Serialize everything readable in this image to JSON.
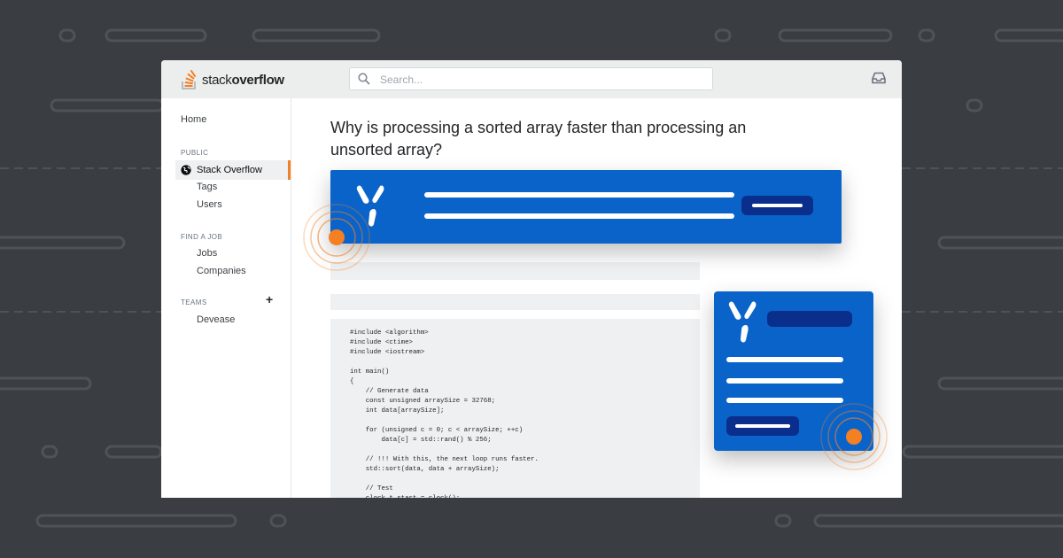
{
  "app": {
    "brand_light": "stack",
    "brand_bold": "overflow"
  },
  "search": {
    "placeholder": "Search..."
  },
  "sidebar": {
    "home": "Home",
    "public_header": "PUBLIC",
    "active_item": "Stack Overflow",
    "tags": "Tags",
    "users": "Users",
    "jobs_header": "FIND A JOB",
    "jobs": "Jobs",
    "companies": "Companies",
    "teams_header": "TEAMS",
    "teams_add": "+",
    "team_name": "Devease"
  },
  "question": {
    "title": "Why is processing a sorted array faster than processing an unsorted array?"
  },
  "code": {
    "text": "#include <algorithm>\n#include <ctime>\n#include <iostream>\n\nint main()\n{\n    // Generate data\n    const unsigned arraySize = 32768;\n    int data[arraySize];\n\n    for (unsigned c = 0; c < arraySize; ++c)\n        data[c] = std::rand() % 256;\n\n    // !!! With this, the next loop runs faster.\n    std::sort(data, data + arraySize);\n\n    // Test\n    clock_t start = clock();"
  },
  "icons": {
    "logo": "stack-overflow-logo",
    "search": "search-icon",
    "inbox": "inbox-icon",
    "globe": "globe-icon",
    "brand_mark": "teams-brand-mark-icon"
  },
  "colors": {
    "background": "#3a3d41",
    "accent_orange": "#f48024",
    "card_blue": "#0a63c8",
    "card_pill": "#0a2e8c",
    "topbar": "#eceded"
  }
}
